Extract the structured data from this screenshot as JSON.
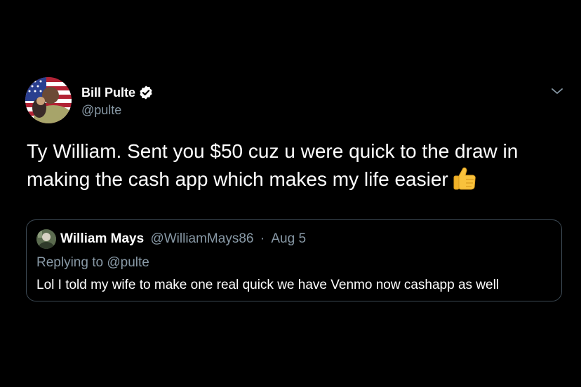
{
  "tweet": {
    "author": {
      "display_name": "Bill Pulte",
      "handle": "@pulte",
      "verified": true,
      "avatar_icon": "user-avatar-flag"
    },
    "text": "Ty William. Sent you $50 cuz u were quick to the draw in making the cash app which makes my life easier",
    "emoji_icon": "thumbs-up-icon",
    "menu_icon": "chevron-down-icon"
  },
  "quoted_tweet": {
    "author": {
      "display_name": "William Mays",
      "handle": "@WilliamMays86",
      "date": "Aug 5",
      "avatar_icon": "user-avatar"
    },
    "separator": "·",
    "replying_to_prefix": "Replying to",
    "replying_to_handle": "@pulte",
    "text": "Lol I told my wife to make one real quick we have Venmo now cashapp as well"
  },
  "colors": {
    "background": "#000000",
    "primary_text": "#ffffff",
    "secondary_text": "#8899a6",
    "border": "#3d4a55",
    "verified_badge": "#ffffff"
  }
}
